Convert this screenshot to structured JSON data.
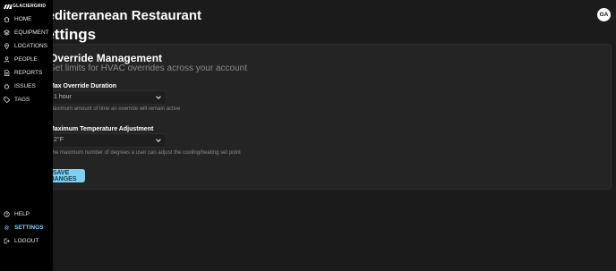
{
  "brand": {
    "name": "GLACIERGRID"
  },
  "header": {
    "restaurant_name": "Mediterranean Restaurant",
    "avatar_initials": "GA"
  },
  "page": {
    "title": "Settings"
  },
  "sidebar": {
    "items": [
      {
        "label": "HOME",
        "icon": "home-icon"
      },
      {
        "label": "EQUIPMENT",
        "icon": "layers-icon"
      },
      {
        "label": "LOCATIONS",
        "icon": "location-pin-icon"
      },
      {
        "label": "PEOPLE",
        "icon": "person-icon"
      },
      {
        "label": "REPORTS",
        "icon": "document-icon"
      },
      {
        "label": "ISSUES",
        "icon": "bug-icon"
      },
      {
        "label": "TAGS",
        "icon": "tag-icon"
      }
    ],
    "bottom_items": [
      {
        "label": "HELP",
        "icon": "help-icon"
      },
      {
        "label": "SETTINGS",
        "icon": "gear-icon",
        "active": true
      },
      {
        "label": "LOGOUT",
        "icon": "logout-icon"
      }
    ]
  },
  "card": {
    "title": "Override Management",
    "subtitle": "Set limits for HVAC overrides across your account",
    "fields": [
      {
        "label": "Max Override Duration",
        "value": "1 hour",
        "help": "Maximum amount of time an override will remain active"
      },
      {
        "label": "Maximum Temperature Adjustment",
        "value": "2°F",
        "help": "The maximum number of degrees a user can adjust the cooling/heating set point"
      }
    ],
    "save_label": "SAVE CHANGES"
  },
  "colors": {
    "accent": "#7fd0f2",
    "background": "#1b1b1b",
    "card": "#242424",
    "sidebar": "#000000"
  }
}
